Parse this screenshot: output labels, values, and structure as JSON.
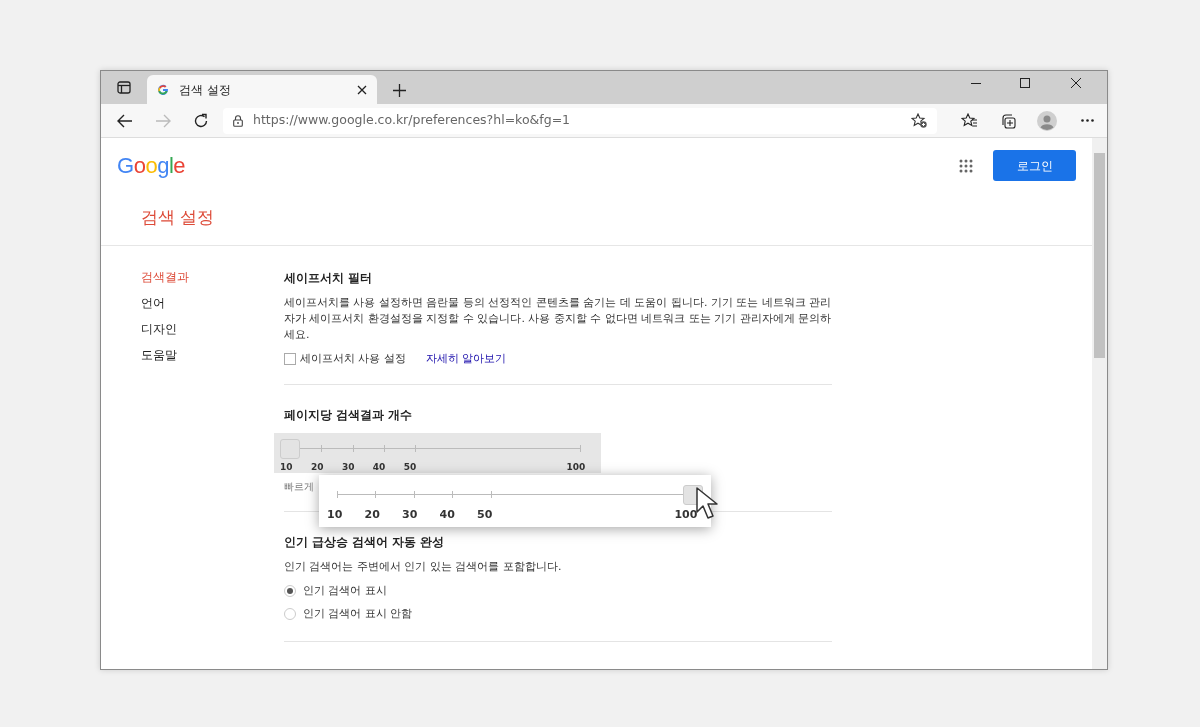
{
  "browser": {
    "tab_title": "검색 설정",
    "url": "https://www.google.co.kr/preferences?hl=ko&fg=1"
  },
  "header": {
    "logo": "Google",
    "login_button": "로그인"
  },
  "page_title": "검색 설정",
  "sidebar": {
    "items": [
      {
        "label": "검색결과",
        "selected": true
      },
      {
        "label": "언어",
        "selected": false
      },
      {
        "label": "디자인",
        "selected": false
      },
      {
        "label": "도움말",
        "selected": false
      }
    ]
  },
  "sections": [
    {
      "kind": "checkbox",
      "title": "세이프서치 필터",
      "description": "세이프서치를 사용 설정하면 음란물 등의 선정적인 콘텐츠를 숨기는 데 도움이 됩니다. 기기 또는 네트워크 관리자가 세이프서치 환경설정을 지정할 수 있습니다. 사용 중지할 수 없다면 네트워크 또는 기기 관리자에게 문의하세요.",
      "checkbox": {
        "label": "세이프서치 사용 설정",
        "checked": false
      },
      "link": "자세히 알아보기"
    },
    {
      "kind": "slider",
      "title": "페이지당 검색결과 개수",
      "slider": {
        "ticks": [
          "10",
          "20",
          "30",
          "40",
          "50",
          "100"
        ],
        "level": 0
      },
      "hint": "빠르게",
      "callout": {
        "ticks": [
          "10",
          "20",
          "30",
          "40",
          "50",
          "100"
        ],
        "level": 1
      }
    },
    {
      "kind": "radio",
      "title": "인기 급상승 검색어 자동 완성",
      "description": "인기 검색어는 주변에서 인기 있는 검색어를 포함합니다.",
      "options": [
        {
          "label": "인기 검색어 표시",
          "selected": true
        },
        {
          "label": "인기 검색어 표시 안함",
          "selected": false
        }
      ]
    }
  ]
}
